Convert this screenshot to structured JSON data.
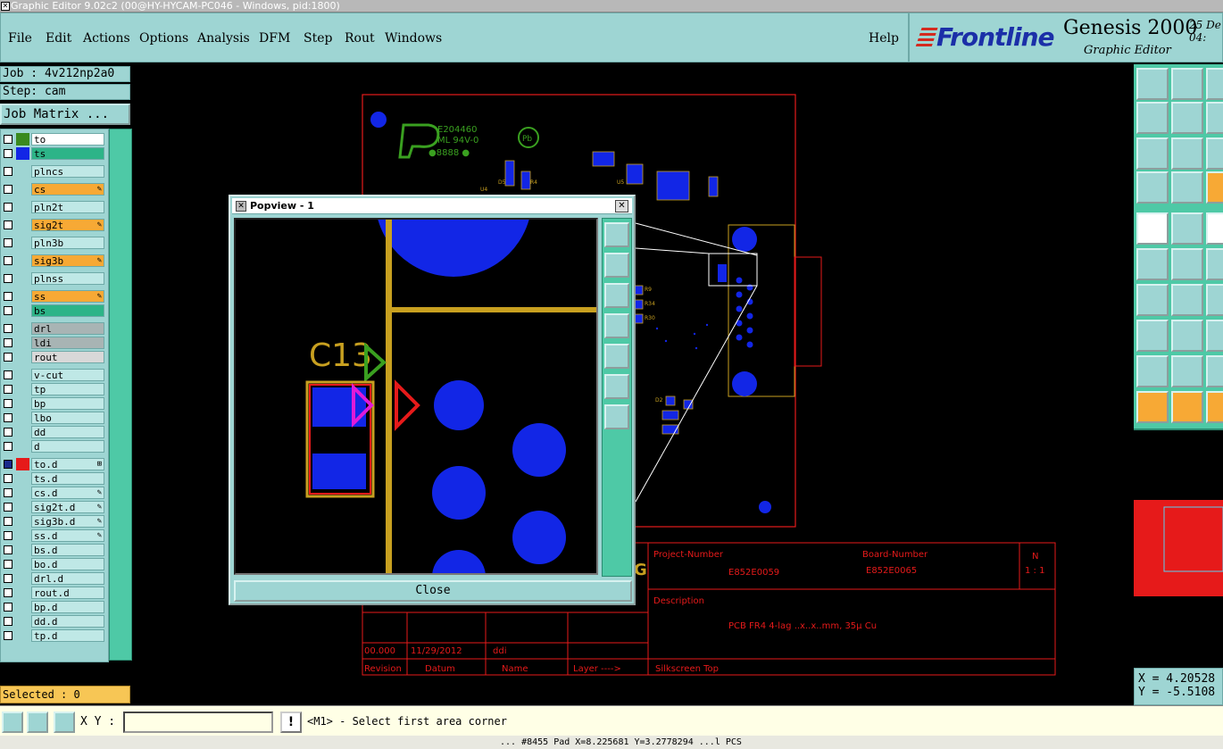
{
  "window": {
    "title": "Graphic Editor 9.02c2 (00@HY-HYCAM-PC046 - Windows, pid:1800)"
  },
  "menu": {
    "file": "File",
    "edit": "Edit",
    "actions": "Actions",
    "options": "Options",
    "analysis": "Analysis",
    "dfm": "DFM",
    "step": "Step",
    "rout": "Rout",
    "windows": "Windows",
    "help": "Help"
  },
  "brand": {
    "logo": "Frontline",
    "product": "Genesis 2000",
    "subtitle": "Graphic Editor",
    "date_line1": "25 De",
    "date_line2": "04:"
  },
  "job": {
    "job_label": "Job : 4v212np2a0",
    "step_label": "Step: cam",
    "job_matrix_button": "Job Matrix ..."
  },
  "layers": [
    {
      "name": "to",
      "color": "#3a8a1e",
      "bg": "#ffffff",
      "flag": "",
      "on": false
    },
    {
      "name": "ts",
      "color": "#1226e6",
      "bg": "#2db488",
      "flag": "",
      "on": false
    },
    {
      "name": "plncs",
      "color": "",
      "bg": "#bfe8e6",
      "flag": "",
      "on": false
    },
    {
      "name": "cs",
      "color": "",
      "bg": "#f7a935",
      "flag": "✎",
      "on": false
    },
    {
      "name": "pln2t",
      "color": "",
      "bg": "#bfe8e6",
      "flag": "",
      "on": false
    },
    {
      "name": "sig2t",
      "color": "",
      "bg": "#f7a935",
      "flag": "✎",
      "on": false
    },
    {
      "name": "pln3b",
      "color": "",
      "bg": "#bfe8e6",
      "flag": "",
      "on": false
    },
    {
      "name": "sig3b",
      "color": "",
      "bg": "#f7a935",
      "flag": "✎",
      "on": false
    },
    {
      "name": "plnss",
      "color": "",
      "bg": "#bfe8e6",
      "flag": "",
      "on": false
    },
    {
      "name": "ss",
      "color": "",
      "bg": "#f7a935",
      "flag": "✎",
      "on": false
    },
    {
      "name": "bs",
      "color": "",
      "bg": "#2db488",
      "flag": "",
      "on": false
    },
    {
      "name": "drl",
      "color": "",
      "bg": "#a8b4b4",
      "flag": "",
      "on": false
    },
    {
      "name": "ldi",
      "color": "",
      "bg": "#a8b4b4",
      "flag": "",
      "on": false
    },
    {
      "name": "rout",
      "color": "",
      "bg": "#d8d8d8",
      "flag": "",
      "on": false
    },
    {
      "name": "v-cut",
      "color": "",
      "bg": "#bfe8e6",
      "flag": "",
      "on": false
    },
    {
      "name": "tp",
      "color": "",
      "bg": "#bfe8e6",
      "flag": "",
      "on": false
    },
    {
      "name": "bp",
      "color": "",
      "bg": "#bfe8e6",
      "flag": "",
      "on": false
    },
    {
      "name": "lbo",
      "color": "",
      "bg": "#bfe8e6",
      "flag": "",
      "on": false
    },
    {
      "name": "dd",
      "color": "",
      "bg": "#bfe8e6",
      "flag": "",
      "on": false
    },
    {
      "name": "d",
      "color": "",
      "bg": "#bfe8e6",
      "flag": "",
      "on": false
    },
    {
      "name": "to.d",
      "color": "#e61a1a",
      "bg": "#bfe8e6",
      "flag": "⊞",
      "on": true
    },
    {
      "name": "ts.d",
      "color": "",
      "bg": "#bfe8e6",
      "flag": "",
      "on": false
    },
    {
      "name": "cs.d",
      "color": "",
      "bg": "#bfe8e6",
      "flag": "✎",
      "on": false
    },
    {
      "name": "sig2t.d",
      "color": "",
      "bg": "#bfe8e6",
      "flag": "✎",
      "on": false
    },
    {
      "name": "sig3b.d",
      "color": "",
      "bg": "#bfe8e6",
      "flag": "✎",
      "on": false
    },
    {
      "name": "ss.d",
      "color": "",
      "bg": "#bfe8e6",
      "flag": "✎",
      "on": false
    },
    {
      "name": "bs.d",
      "color": "",
      "bg": "#bfe8e6",
      "flag": "",
      "on": false
    },
    {
      "name": "bo.d",
      "color": "",
      "bg": "#bfe8e6",
      "flag": "",
      "on": false
    },
    {
      "name": "drl.d",
      "color": "",
      "bg": "#bfe8e6",
      "flag": "",
      "on": false
    },
    {
      "name": "rout.d",
      "color": "",
      "bg": "#bfe8e6",
      "flag": "",
      "on": false
    },
    {
      "name": "bp.d",
      "color": "",
      "bg": "#bfe8e6",
      "flag": "",
      "on": false
    },
    {
      "name": "dd.d",
      "color": "",
      "bg": "#bfe8e6",
      "flag": "",
      "on": false
    },
    {
      "name": "tp.d",
      "color": "",
      "bg": "#bfe8e6",
      "flag": "",
      "on": false
    }
  ],
  "selected": "Selected : 0",
  "board": {
    "ul_mark": "E204460",
    "ul_grade": "ML 94V-0",
    "ul_dots": "●8888 ●",
    "pb_mark": "Pb",
    "title_block": {
      "project_number_label": "Project-Number",
      "project_number_value": "E852E0059",
      "board_number_label": "Board-Number",
      "board_number_value": "E852E0065",
      "n_label": "N",
      "n_value": "1 : 1",
      "description_label": "Description",
      "description_value": "PCB FR4 4-lag ..x..x..mm, 35μ Cu",
      "revision_value": "00.000",
      "date_value": "11/29/2012",
      "name_value": "ddi",
      "col_revision": "Revision",
      "col_datum": "Datum",
      "col_name": "Name",
      "col_layer": "Layer ---->",
      "col_silkscreen": "Silkscreen Top",
      "g_mark": "G"
    },
    "ref_labels": [
      "R4",
      "R9",
      "R34",
      "R30",
      "U5",
      "U4",
      "D2",
      "D5"
    ]
  },
  "popview": {
    "title": "Popview - 1",
    "close_button": "Close",
    "close_x": "✕",
    "component_label": "C13"
  },
  "coords": {
    "x": "X = 4.20528",
    "y": "Y = -5.5108"
  },
  "bottom": {
    "xy_label": "X Y :",
    "xy_value": "",
    "warn": "!",
    "message": "<M1> - Select first area corner"
  },
  "status": "... #8455 Pad X=8.225681 Y=3.2778294 ...l PCS",
  "colors": {
    "panel": "#9ed5d3",
    "accent_green": "#4ec9a6",
    "orange": "#f7a935",
    "board_outline": "#e61a1a",
    "pad_blue": "#1226e6",
    "silk_yellow": "#c8a020"
  }
}
